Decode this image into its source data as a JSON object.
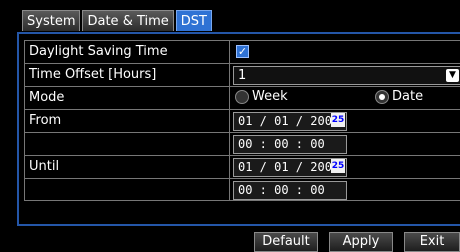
{
  "tabs": [
    {
      "label": "System",
      "active": false
    },
    {
      "label": "Date & Time",
      "active": false
    },
    {
      "label": "DST",
      "active": true
    }
  ],
  "settings": {
    "dst": {
      "label": "Daylight Saving Time",
      "checked": true,
      "check_mark": "✓"
    },
    "time_offset": {
      "label": "Time Offset [Hours]",
      "value": "1",
      "arrow": "▼"
    },
    "mode": {
      "label": "Mode",
      "options": [
        "Week",
        "Date"
      ],
      "selected": "Date"
    },
    "from": {
      "label": "From",
      "date": "01 / 01 / 2008",
      "time": "00 : 00 : 00",
      "calendar_icon_text": "25"
    },
    "until": {
      "label": "Until",
      "date": "01 / 01 / 2008",
      "time": "00 : 00 : 00",
      "calendar_icon_text": "25"
    }
  },
  "buttons": {
    "default": "Default",
    "apply": "Apply",
    "exit": "Exit"
  },
  "colors": {
    "active_tab": "#2f72d4",
    "panel_border": "#2456a8",
    "background": "#000000"
  }
}
